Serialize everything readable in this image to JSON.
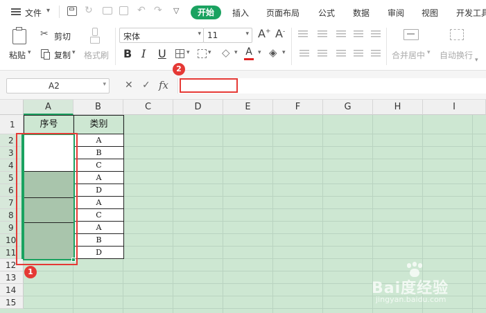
{
  "menu": {
    "file": "文件",
    "tabs": [
      "开始",
      "插入",
      "页面布局",
      "公式",
      "数据",
      "审阅",
      "视图",
      "开发工具"
    ]
  },
  "ribbon": {
    "paste": "粘贴",
    "cut": "剪切",
    "copy": "复制",
    "format_painter": "格式刷",
    "font_name": "宋体",
    "font_size": "11",
    "bold": "B",
    "italic": "I",
    "underline": "U",
    "merge_center": "合并居中",
    "wrap_text": "自动换行"
  },
  "formula_bar": {
    "name_box": "A2",
    "fx": "fx",
    "value": ""
  },
  "sheet": {
    "columns": [
      "A",
      "B",
      "C",
      "D",
      "E",
      "F",
      "G",
      "H",
      "I"
    ],
    "rows": [
      "1",
      "2",
      "3",
      "4",
      "5",
      "6",
      "7",
      "8",
      "9",
      "10",
      "11",
      "12",
      "13",
      "14",
      "15"
    ],
    "header_a": "序号",
    "header_b": "类别",
    "category_values": [
      "A",
      "B",
      "C",
      "A",
      "D",
      "A",
      "C",
      "A",
      "B",
      "D"
    ]
  },
  "annotations": [
    "1",
    "2"
  ],
  "watermark": {
    "brand": "Bai度经验",
    "url": "jingyan.baidu.com"
  },
  "colors": {
    "accent_green": "#1aa260",
    "sheet_bg": "#cde7d2",
    "merged_cell": "#a9c5ac",
    "annotation_red": "#e53935"
  }
}
